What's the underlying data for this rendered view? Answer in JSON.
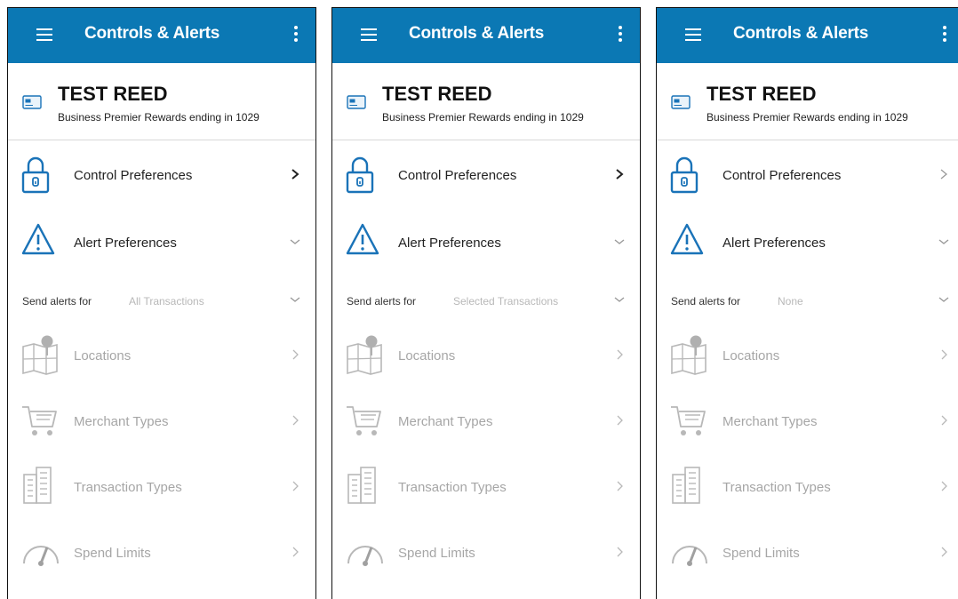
{
  "colors": {
    "app_bar": "#0b78b4",
    "primary_icon": "#1a73b8",
    "dim_icon": "#b8b8b8",
    "dim_text": "#a6a6a6"
  },
  "panels": [
    {
      "app_bar": {
        "title": "Controls & Alerts",
        "menu_icon": "hamburger-menu-icon",
        "overflow_icon": "more-vert-icon"
      },
      "account": {
        "name": "TEST REED",
        "description": "Business Premier Rewards ending in 1029"
      },
      "control_preferences": {
        "label": "Control Preferences"
      },
      "alert_preferences": {
        "label": "Alert Preferences",
        "expanded": true
      },
      "send_alerts": {
        "label": "Send alerts for",
        "value": "All Transactions"
      },
      "items": [
        {
          "label": "Locations",
          "icon": "map-pin-icon"
        },
        {
          "label": "Merchant Types",
          "icon": "shopping-cart-icon"
        },
        {
          "label": "Transaction Types",
          "icon": "building-icon"
        },
        {
          "label": "Spend Limits",
          "icon": "speedometer-icon"
        }
      ]
    },
    {
      "app_bar": {
        "title": "Controls & Alerts",
        "menu_icon": "hamburger-menu-icon",
        "overflow_icon": "more-vert-icon"
      },
      "account": {
        "name": "TEST REED",
        "description": "Business Premier Rewards ending in 1029"
      },
      "control_preferences": {
        "label": "Control Preferences"
      },
      "alert_preferences": {
        "label": "Alert Preferences",
        "expanded": true
      },
      "send_alerts": {
        "label": "Send alerts for",
        "value": "Selected Transactions"
      },
      "items": [
        {
          "label": "Locations",
          "icon": "map-pin-icon"
        },
        {
          "label": "Merchant Types",
          "icon": "shopping-cart-icon"
        },
        {
          "label": "Transaction Types",
          "icon": "building-icon"
        },
        {
          "label": "Spend Limits",
          "icon": "speedometer-icon"
        }
      ]
    },
    {
      "app_bar": {
        "title": "Controls & Alerts",
        "menu_icon": "hamburger-menu-icon",
        "overflow_icon": "more-vert-icon"
      },
      "account": {
        "name": "TEST REED",
        "description": "Business Premier Rewards ending in 1029"
      },
      "control_preferences": {
        "label": "Control Preferences"
      },
      "alert_preferences": {
        "label": "Alert Preferences",
        "expanded": true
      },
      "send_alerts": {
        "label": "Send alerts for",
        "value": "None"
      },
      "items": [
        {
          "label": "Locations",
          "icon": "map-pin-icon"
        },
        {
          "label": "Merchant Types",
          "icon": "shopping-cart-icon"
        },
        {
          "label": "Transaction Types",
          "icon": "building-icon"
        },
        {
          "label": "Spend Limits",
          "icon": "speedometer-icon"
        }
      ]
    }
  ]
}
